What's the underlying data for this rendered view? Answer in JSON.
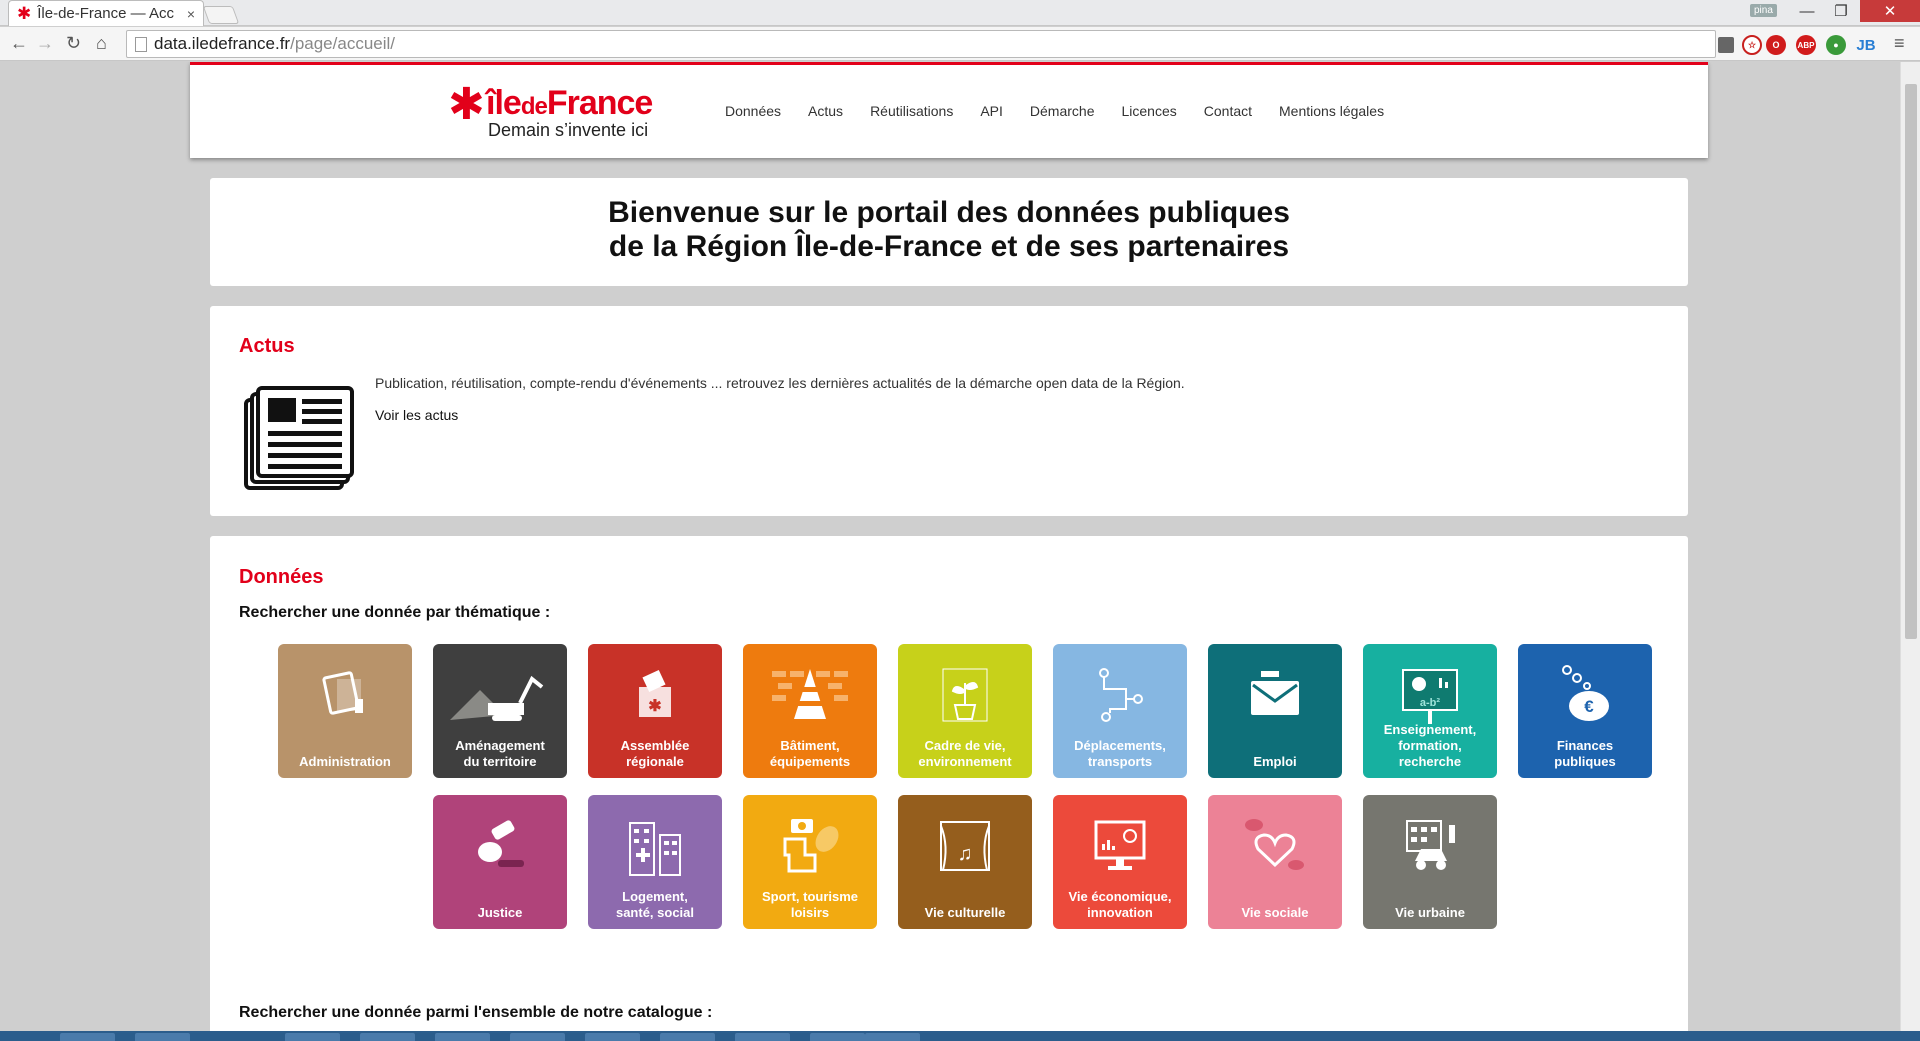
{
  "browser": {
    "tab_title": "Île-de-France — Acc",
    "tab_close": "×",
    "user_badge": "pina",
    "url_host": "data.iledefrance.fr",
    "url_path": "/page/accueil/",
    "extensions": [
      "ABP",
      "JB"
    ]
  },
  "header": {
    "logo_brand_1": "île",
    "logo_brand_2": "de",
    "logo_brand_3": "France",
    "logo_tagline": "Demain s’invente ici",
    "nav": [
      "Données",
      "Actus",
      "Réutilisations",
      "API",
      "Démarche",
      "Licences",
      "Contact",
      "Mentions légales"
    ]
  },
  "welcome": {
    "line1": "Bienvenue sur le portail des données publiques",
    "line2": "de la Région Île-de-France et de ses partenaires"
  },
  "actus": {
    "title": "Actus",
    "description": "Publication, réutilisation, compte-rendu d'événements ... retrouvez les dernières actualités de la démarche open data de la Région.",
    "link": "Voir les actus"
  },
  "donnees": {
    "title": "Données",
    "by_theme": "Rechercher une donnée par thématique :",
    "catalogue": "Rechercher une donnée parmi l'ensemble de notre catalogue :",
    "themes": [
      {
        "label": "Administration",
        "color": "#b8936a",
        "icon": "documents-icon"
      },
      {
        "label": "Aménagement\ndu territoire",
        "color": "#3f3f3f",
        "icon": "excavator-icon"
      },
      {
        "label": "Assemblée\nrégionale",
        "color": "#c83228",
        "icon": "ballot-box-icon"
      },
      {
        "label": "Bâtiment,\néquipements",
        "color": "#ee7b0e",
        "icon": "traffic-cone-icon"
      },
      {
        "label": "Cadre de vie,\nenvironnement",
        "color": "#c7d11a",
        "icon": "plant-icon"
      },
      {
        "label": "Déplacements,\ntransports",
        "color": "#86b7e2",
        "icon": "route-icon"
      },
      {
        "label": "Emploi",
        "color": "#0e6f79",
        "icon": "envelope-icon"
      },
      {
        "label": "Enseignement,\nformation, recherche",
        "color": "#17b0a0",
        "icon": "blackboard-icon"
      },
      {
        "label": "Finances\npubliques",
        "color": "#1d63ae",
        "icon": "piggy-bank-icon"
      },
      {
        "label": "Justice",
        "color": "#b0437a",
        "icon": "gavel-icon"
      },
      {
        "label": "Logement,\nsanté, social",
        "color": "#8d6aae",
        "icon": "buildings-icon"
      },
      {
        "label": "Sport, tourisme\nloisirs",
        "color": "#f2aa11",
        "icon": "camera-boot-icon"
      },
      {
        "label": "Vie culturelle",
        "color": "#955e1d",
        "icon": "theater-icon"
      },
      {
        "label": "Vie économique,\ninnovation",
        "color": "#ec4a3b",
        "icon": "monitor-idea-icon"
      },
      {
        "label": "Vie sociale",
        "color": "#ec8296",
        "icon": "heart-chat-icon"
      },
      {
        "label": "Vie urbaine",
        "color": "#76766f",
        "icon": "city-car-icon"
      }
    ]
  }
}
